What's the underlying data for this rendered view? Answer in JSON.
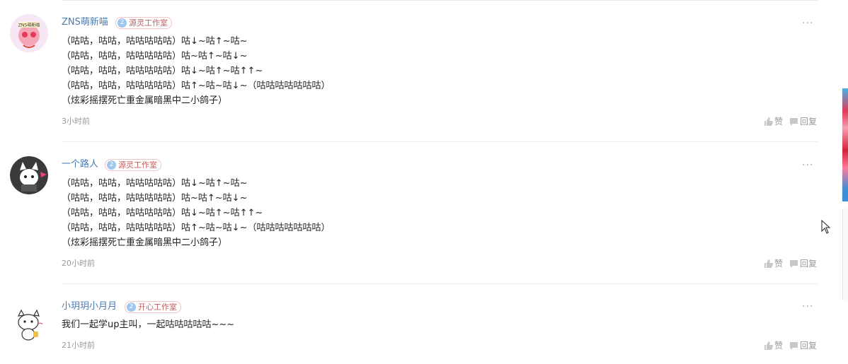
{
  "comments": [
    {
      "username": "ZNS萌新喵",
      "avatar_text": "ZNS萌新喵",
      "level": "2",
      "group": "源灵工作室",
      "lines": [
        "（咕咕，咕咕，咕咕咕咕咕）咕↓~咕↑~咕~",
        "（咕咕，咕咕，咕咕咕咕咕）咕~咕↑~咕↓~",
        "（咕咕，咕咕，咕咕咕咕咕）咕↓~咕↑~咕↑↑~",
        "（咕咕，咕咕，咕咕咕咕咕）咕↑~咕~咕↓~（咕咕咕咕咕咕咕）",
        "（炫彩摇摆死亡重金属暗黑中二小鸽子）"
      ],
      "time": "3小时前",
      "like_label": "赞",
      "reply_label": "回复",
      "more_label": "···"
    },
    {
      "username": "一个路人",
      "level": "2",
      "group": "源灵工作室",
      "lines": [
        "（咕咕，咕咕，咕咕咕咕咕）咕↓~咕↑~咕~",
        "（咕咕，咕咕，咕咕咕咕咕）咕~咕↑~咕↓~",
        "（咕咕，咕咕，咕咕咕咕咕）咕↓~咕↑~咕↑↑~",
        "（咕咕，咕咕，咕咕咕咕咕）咕↑~咕~咕↓~（咕咕咕咕咕咕咕）",
        "（炫彩摇摆死亡重金属暗黑中二小鸽子）"
      ],
      "time": "20小时前",
      "like_label": "赞",
      "reply_label": "回复",
      "more_label": "···"
    },
    {
      "username": "小玥玥小月月",
      "level": "2",
      "group": "开心工作室",
      "lines": [
        "我们一起学up主叫，一起咕咕咕咕咕~~~"
      ],
      "time": "21小时前",
      "like_label": "赞",
      "reply_label": "回复",
      "more_label": "···"
    }
  ],
  "colors": {
    "username": "#4a7bb3",
    "badge_border": "#f0c6c6",
    "badge_text": "#c06060",
    "level_circle": "#9ec6ee",
    "meta": "#999999"
  }
}
